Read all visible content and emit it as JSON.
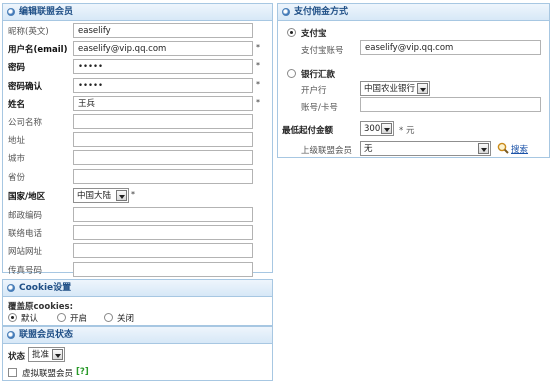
{
  "member_panel": {
    "title": "编辑联盟会员",
    "fields": [
      {
        "label": "昵称(英文)",
        "bold": false,
        "value": "easelify",
        "required": false
      },
      {
        "label": "用户名(email)",
        "bold": true,
        "value": "easelify@vip.qq.com",
        "required": true
      },
      {
        "label": "密码",
        "bold": true,
        "value": "•••••",
        "required": true
      },
      {
        "label": "密码确认",
        "bold": true,
        "value": "•••••",
        "required": true
      },
      {
        "label": "姓名",
        "bold": true,
        "value": "王兵",
        "required": true
      },
      {
        "label": "公司名称",
        "bold": false,
        "value": "",
        "required": false
      },
      {
        "label": "地址",
        "bold": false,
        "value": "",
        "required": false
      },
      {
        "label": "城市",
        "bold": false,
        "value": "",
        "required": false
      },
      {
        "label": "省份",
        "bold": false,
        "value": "",
        "required": false
      }
    ],
    "country_label": "国家/地区",
    "country_value": "中国大陆",
    "fields_after": [
      {
        "label": "邮政编码",
        "value": ""
      },
      {
        "label": "联络电话",
        "value": ""
      },
      {
        "label": "网站网址",
        "value": ""
      },
      {
        "label": "传真号码",
        "value": ""
      }
    ],
    "required_mark": "*"
  },
  "cookie_panel": {
    "title": "Cookie设置",
    "label": "覆盖原cookies:",
    "options": [
      "默认",
      "开启",
      "关闭"
    ],
    "selected": 0
  },
  "status_panel": {
    "title": "联盟会员状态",
    "status_label": "状态",
    "status_value": "批准",
    "virtual_label": "虚拟联盟会员",
    "help": "[?]"
  },
  "payment_panel": {
    "title": "支付佣金方式",
    "alipay_label": "支付宝",
    "alipay_account_label": "支付宝账号",
    "alipay_account_value": "easelify@vip.qq.com",
    "bank_label": "银行汇款",
    "bank_name_label": "开户行",
    "bank_name_value": "中国农业银行",
    "bank_account_label": "账号/卡号",
    "bank_account_value": "",
    "min_label": "最低起付金额",
    "min_value": "300",
    "min_unit": "* 元",
    "parent_label": "上级联盟会员",
    "parent_value": "无",
    "search_link": "搜索"
  },
  "colors": {
    "accent": "#1f4f86",
    "border": "#a7c7e2",
    "help": "#2a9a2a",
    "link": "#1a52a8"
  },
  "icons": [
    "panel-bullet-icon",
    "dropdown-arrow-icon",
    "magnifier-icon"
  ]
}
